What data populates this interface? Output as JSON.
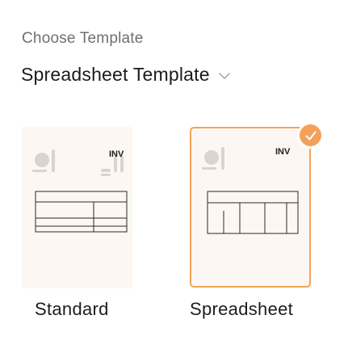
{
  "heading": "Choose Template",
  "template_select": {
    "value": "Spreadsheet Template",
    "icon": "chevron-down-icon"
  },
  "cards": [
    {
      "id": "standard",
      "title": "Standard",
      "thumb_label": "INV",
      "selected": false
    },
    {
      "id": "spreadsheet",
      "title": "Spreadsheet",
      "thumb_label": "INV",
      "selected": true
    }
  ],
  "colors": {
    "accent": "#f3a15a",
    "card_bg": "#fcf7f2",
    "thumb_gray": "#d9d4d0",
    "heading_gray": "#6f6f6f"
  }
}
